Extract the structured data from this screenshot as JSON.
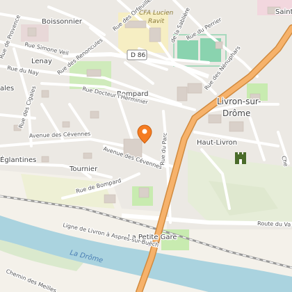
{
  "map": {
    "places": {
      "boissonnier": "Boissonnier",
      "lenay": "Lenay",
      "bompard": "Bompard",
      "tournier": "Tournier",
      "eglantines": "Églantines",
      "ales": "ales",
      "haut_livron": "Haut-Livron",
      "livron_line1": "Livron-sur-",
      "livron_line2": "Drôme",
      "saint": "Saint",
      "cfa_line1": "CFA Lucien",
      "cfa_line2": "Ravit",
      "petite_gare": "La Petite Gare"
    },
    "roads": {
      "d86": "D 86",
      "orfeuilles": "Rue des Orfeuilles",
      "sablieres": "de la Sablière",
      "perrier": "Rue du Perrier",
      "nenuphars": "Rue des Nénuphars",
      "provence": "Rue de Provence",
      "simone_veil": "Rue Simone Veil",
      "renoncules": "Rue des Renoncules",
      "nay": "Rue du Nay",
      "docteur": "Rue Docteur l'Herminier",
      "cigales": "Rue des Cigales",
      "cevennes1": "Avenue des Cévennes",
      "cevennes2": "Avenue des Cévennes",
      "parc": "Rue du Parc",
      "bompard": "Rue de Bompard",
      "route_va": "Route du Va",
      "railway": "Ligne de Livron à Aspres-sur-Buëch",
      "meilles": "Chemin des Meilles",
      "che": "Che"
    },
    "water": {
      "drome": "La Drôme"
    },
    "icons": {
      "pin": "location-pin-icon",
      "monument": "castle-icon",
      "station": "railway-station-icon",
      "rail_crossing": "level-crossing-icon"
    },
    "colors": {
      "background": "#f2efe9",
      "primary_road": "#f6b26b",
      "primary_road_casing": "#d18a3e",
      "river": "#aad3df",
      "park": "#c8ebb0",
      "residential": "#e0dfdf",
      "pin": "#f57c22"
    }
  }
}
